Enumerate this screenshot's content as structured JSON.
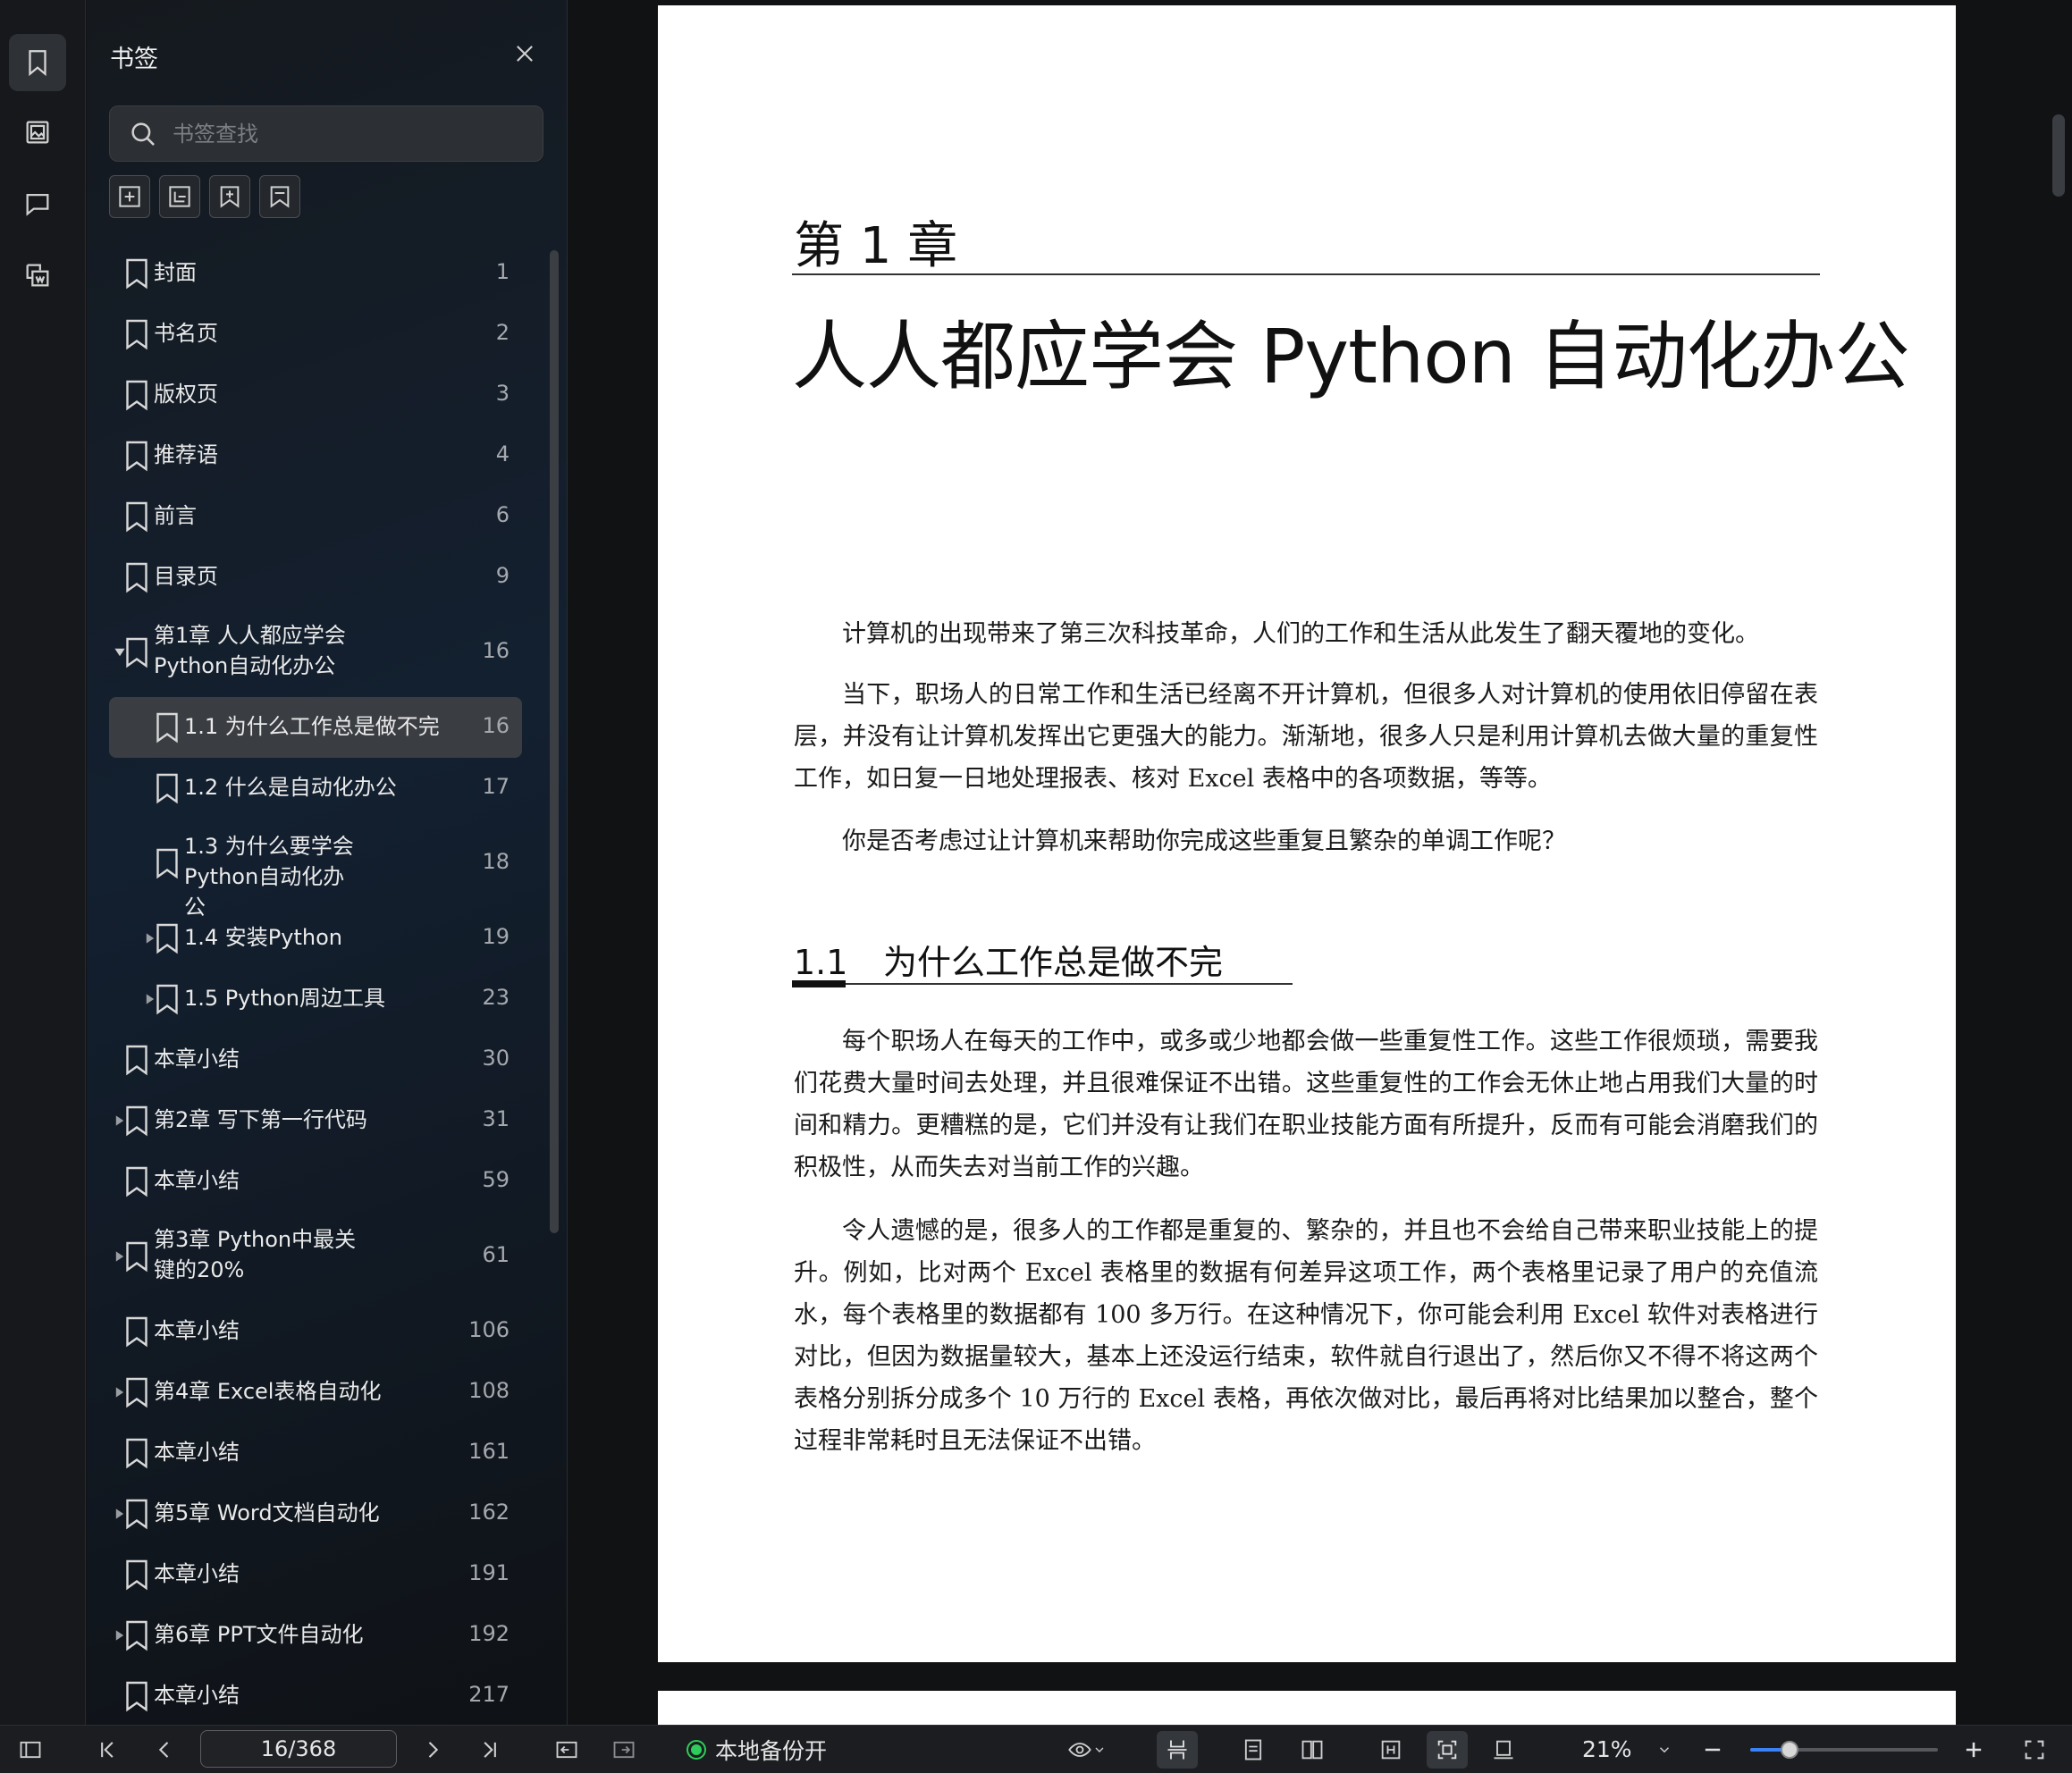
{
  "panel": {
    "title": "书签",
    "search_placeholder": "书签查找"
  },
  "bookmarks": [
    {
      "label": "封面",
      "page": "1",
      "level": 0,
      "expander": "none"
    },
    {
      "label": "书名页",
      "page": "2",
      "level": 0,
      "expander": "none"
    },
    {
      "label": "版权页",
      "page": "3",
      "level": 0,
      "expander": "none"
    },
    {
      "label": "推荐语",
      "page": "4",
      "level": 0,
      "expander": "none"
    },
    {
      "label": "前言",
      "page": "6",
      "level": 0,
      "expander": "none"
    },
    {
      "label": "目录页",
      "page": "9",
      "level": 0,
      "expander": "none"
    },
    {
      "label": "第1章 人人都应学会Python自动化办公",
      "page": "16",
      "level": 0,
      "expander": "expanded"
    },
    {
      "label": "1.1 为什么工作总是做不完",
      "page": "16",
      "level": 1,
      "expander": "none",
      "selected": true
    },
    {
      "label": "1.2 什么是自动化办公",
      "page": "17",
      "level": 1,
      "expander": "none"
    },
    {
      "label": "1.3 为什么要学会Python自动化办公",
      "page": "18",
      "level": 1,
      "expander": "none"
    },
    {
      "label": "1.4 安装Python",
      "page": "19",
      "level": 1,
      "expander": "collapsed"
    },
    {
      "label": "1.5 Python周边工具",
      "page": "23",
      "level": 1,
      "expander": "collapsed"
    },
    {
      "label": "本章小结",
      "page": "30",
      "level": 0,
      "expander": "none"
    },
    {
      "label": "第2章 写下第一行代码",
      "page": "31",
      "level": 0,
      "expander": "collapsed"
    },
    {
      "label": "本章小结",
      "page": "59",
      "level": 0,
      "expander": "none"
    },
    {
      "label": "第3章 Python中最关键的20%",
      "page": "61",
      "level": 0,
      "expander": "collapsed"
    },
    {
      "label": "本章小结",
      "page": "106",
      "level": 0,
      "expander": "none"
    },
    {
      "label": "第4章 Excel表格自动化",
      "page": "108",
      "level": 0,
      "expander": "collapsed"
    },
    {
      "label": "本章小结",
      "page": "161",
      "level": 0,
      "expander": "none"
    },
    {
      "label": "第5章 Word文档自动化",
      "page": "162",
      "level": 0,
      "expander": "collapsed"
    },
    {
      "label": "本章小结",
      "page": "191",
      "level": 0,
      "expander": "none"
    },
    {
      "label": "第6章 PPT文件自动化",
      "page": "192",
      "level": 0,
      "expander": "collapsed"
    },
    {
      "label": "本章小结",
      "page": "217",
      "level": 0,
      "expander": "none"
    }
  ],
  "document": {
    "chapter_number": "第 1 章",
    "chapter_title": "人人都应学会 Python 自动化办公",
    "intro_paragraphs": [
      "计算机的出现带来了第三次科技革命，人们的工作和生活从此发生了翻天覆地的变化。",
      "当下，职场人的日常工作和生活已经离不开计算机，但很多人对计算机的使用依旧停留在表层，并没有让计算机发挥出它更强大的能力。渐渐地，很多人只是利用计算机去做大量的重复性工作，如日复一日地处理报表、核对 Excel 表格中的各项数据，等等。",
      "你是否考虑过让计算机来帮助你完成这些重复且繁杂的单调工作呢？"
    ],
    "section_number": "1.1",
    "section_title": "为什么工作总是做不完",
    "section_paragraphs": [
      "每个职场人在每天的工作中，或多或少地都会做一些重复性工作。这些工作很烦琐，需要我们花费大量时间去处理，并且很难保证不出错。这些重复性的工作会无休止地占用我们大量的时间和精力。更糟糕的是，它们并没有让我们在职业技能方面有所提升，反而有可能会消磨我们的积极性，从而失去对当前工作的兴趣。",
      "令人遗憾的是，很多人的工作都是重复的、繁杂的，并且也不会给自己带来职业技能上的提升。例如，比对两个 Excel 表格里的数据有何差异这项工作，两个表格里记录了用户的充值流水，每个表格里的数据都有 100 多万行。在这种情况下，你可能会利用 Excel 软件对表格进行对比，但因为数据量较大，基本上还没运行结束，软件就自行退出了，然后你又不得不将这两个表格分别拆分成多个 10 万行的 Excel 表格，再依次做对比，最后再将对比结果加以整合，整个过程非常耗时且无法保证不出错。"
    ]
  },
  "statusbar": {
    "page_indicator": "16/368",
    "backup_label": "本地备份开",
    "zoom_label": "21%",
    "zoom_fraction": 0.21
  },
  "colors": {
    "accent": "#3b82f6",
    "backup_status": "#2ecc5a",
    "selected_row": "#3a3d42"
  }
}
